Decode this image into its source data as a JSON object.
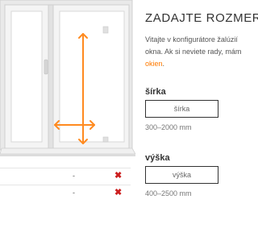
{
  "header": {
    "title": "ZADAJTE ROZMERY"
  },
  "intro": {
    "line1": "Vitajte v konfigurátore žalúzií",
    "line2": "okna. Ak si neviete rady, mám",
    "link": "okien",
    "link_suffix": "."
  },
  "width_field": {
    "label": "šírka",
    "placeholder": "šírka",
    "hint": "300–2000 mm"
  },
  "height_field": {
    "label": "výška",
    "placeholder": "výška",
    "hint": "400–2500 mm"
  },
  "summary": {
    "rows": [
      {
        "value": "-",
        "remove": "✖"
      },
      {
        "value": "-",
        "remove": "✖"
      }
    ]
  },
  "colors": {
    "accent": "#ff7a00",
    "remove": "#cc1f1f",
    "frame": "#dadada"
  },
  "icons": {
    "height_arrow": "vertical-double-arrow-icon",
    "width_arrow": "horizontal-double-arrow-icon",
    "remove": "close-x-icon"
  }
}
